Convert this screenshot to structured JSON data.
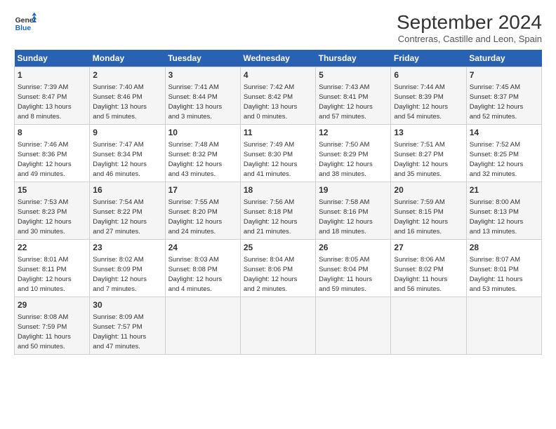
{
  "header": {
    "logo_line1": "General",
    "logo_line2": "Blue",
    "main_title": "September 2024",
    "subtitle": "Contreras, Castille and Leon, Spain"
  },
  "days_of_week": [
    "Sunday",
    "Monday",
    "Tuesday",
    "Wednesday",
    "Thursday",
    "Friday",
    "Saturday"
  ],
  "weeks": [
    [
      {
        "day": "1",
        "info": "Sunrise: 7:39 AM\nSunset: 8:47 PM\nDaylight: 13 hours\nand 8 minutes."
      },
      {
        "day": "2",
        "info": "Sunrise: 7:40 AM\nSunset: 8:46 PM\nDaylight: 13 hours\nand 5 minutes."
      },
      {
        "day": "3",
        "info": "Sunrise: 7:41 AM\nSunset: 8:44 PM\nDaylight: 13 hours\nand 3 minutes."
      },
      {
        "day": "4",
        "info": "Sunrise: 7:42 AM\nSunset: 8:42 PM\nDaylight: 13 hours\nand 0 minutes."
      },
      {
        "day": "5",
        "info": "Sunrise: 7:43 AM\nSunset: 8:41 PM\nDaylight: 12 hours\nand 57 minutes."
      },
      {
        "day": "6",
        "info": "Sunrise: 7:44 AM\nSunset: 8:39 PM\nDaylight: 12 hours\nand 54 minutes."
      },
      {
        "day": "7",
        "info": "Sunrise: 7:45 AM\nSunset: 8:37 PM\nDaylight: 12 hours\nand 52 minutes."
      }
    ],
    [
      {
        "day": "8",
        "info": "Sunrise: 7:46 AM\nSunset: 8:36 PM\nDaylight: 12 hours\nand 49 minutes."
      },
      {
        "day": "9",
        "info": "Sunrise: 7:47 AM\nSunset: 8:34 PM\nDaylight: 12 hours\nand 46 minutes."
      },
      {
        "day": "10",
        "info": "Sunrise: 7:48 AM\nSunset: 8:32 PM\nDaylight: 12 hours\nand 43 minutes."
      },
      {
        "day": "11",
        "info": "Sunrise: 7:49 AM\nSunset: 8:30 PM\nDaylight: 12 hours\nand 41 minutes."
      },
      {
        "day": "12",
        "info": "Sunrise: 7:50 AM\nSunset: 8:29 PM\nDaylight: 12 hours\nand 38 minutes."
      },
      {
        "day": "13",
        "info": "Sunrise: 7:51 AM\nSunset: 8:27 PM\nDaylight: 12 hours\nand 35 minutes."
      },
      {
        "day": "14",
        "info": "Sunrise: 7:52 AM\nSunset: 8:25 PM\nDaylight: 12 hours\nand 32 minutes."
      }
    ],
    [
      {
        "day": "15",
        "info": "Sunrise: 7:53 AM\nSunset: 8:23 PM\nDaylight: 12 hours\nand 30 minutes."
      },
      {
        "day": "16",
        "info": "Sunrise: 7:54 AM\nSunset: 8:22 PM\nDaylight: 12 hours\nand 27 minutes."
      },
      {
        "day": "17",
        "info": "Sunrise: 7:55 AM\nSunset: 8:20 PM\nDaylight: 12 hours\nand 24 minutes."
      },
      {
        "day": "18",
        "info": "Sunrise: 7:56 AM\nSunset: 8:18 PM\nDaylight: 12 hours\nand 21 minutes."
      },
      {
        "day": "19",
        "info": "Sunrise: 7:58 AM\nSunset: 8:16 PM\nDaylight: 12 hours\nand 18 minutes."
      },
      {
        "day": "20",
        "info": "Sunrise: 7:59 AM\nSunset: 8:15 PM\nDaylight: 12 hours\nand 16 minutes."
      },
      {
        "day": "21",
        "info": "Sunrise: 8:00 AM\nSunset: 8:13 PM\nDaylight: 12 hours\nand 13 minutes."
      }
    ],
    [
      {
        "day": "22",
        "info": "Sunrise: 8:01 AM\nSunset: 8:11 PM\nDaylight: 12 hours\nand 10 minutes."
      },
      {
        "day": "23",
        "info": "Sunrise: 8:02 AM\nSunset: 8:09 PM\nDaylight: 12 hours\nand 7 minutes."
      },
      {
        "day": "24",
        "info": "Sunrise: 8:03 AM\nSunset: 8:08 PM\nDaylight: 12 hours\nand 4 minutes."
      },
      {
        "day": "25",
        "info": "Sunrise: 8:04 AM\nSunset: 8:06 PM\nDaylight: 12 hours\nand 2 minutes."
      },
      {
        "day": "26",
        "info": "Sunrise: 8:05 AM\nSunset: 8:04 PM\nDaylight: 11 hours\nand 59 minutes."
      },
      {
        "day": "27",
        "info": "Sunrise: 8:06 AM\nSunset: 8:02 PM\nDaylight: 11 hours\nand 56 minutes."
      },
      {
        "day": "28",
        "info": "Sunrise: 8:07 AM\nSunset: 8:01 PM\nDaylight: 11 hours\nand 53 minutes."
      }
    ],
    [
      {
        "day": "29",
        "info": "Sunrise: 8:08 AM\nSunset: 7:59 PM\nDaylight: 11 hours\nand 50 minutes."
      },
      {
        "day": "30",
        "info": "Sunrise: 8:09 AM\nSunset: 7:57 PM\nDaylight: 11 hours\nand 47 minutes."
      },
      null,
      null,
      null,
      null,
      null
    ]
  ]
}
